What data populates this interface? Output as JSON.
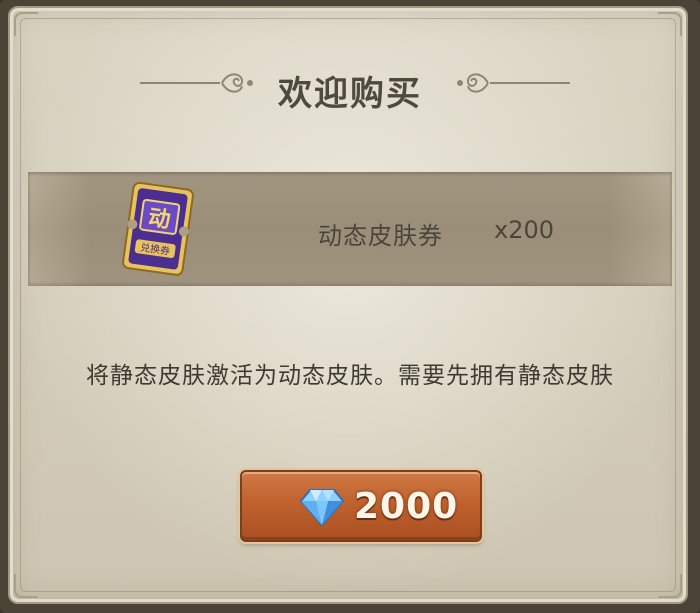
{
  "dialog": {
    "title": "欢迎购买"
  },
  "item": {
    "name": "动态皮肤券",
    "quantity": "x200",
    "icon_main_char": "动",
    "icon_label": "兑换券",
    "icon": "dynamic-skin-ticket-icon"
  },
  "description": "将静态皮肤激活为动态皮肤。需要先拥有静态皮肤",
  "buy_button": {
    "price": "2000",
    "currency_icon": "diamond-icon"
  },
  "colors": {
    "panel_bg": "#d6cfbd",
    "button": "#c0622e",
    "ticket_purple": "#4b2e8f",
    "ticket_gold": "#e8c25a"
  }
}
